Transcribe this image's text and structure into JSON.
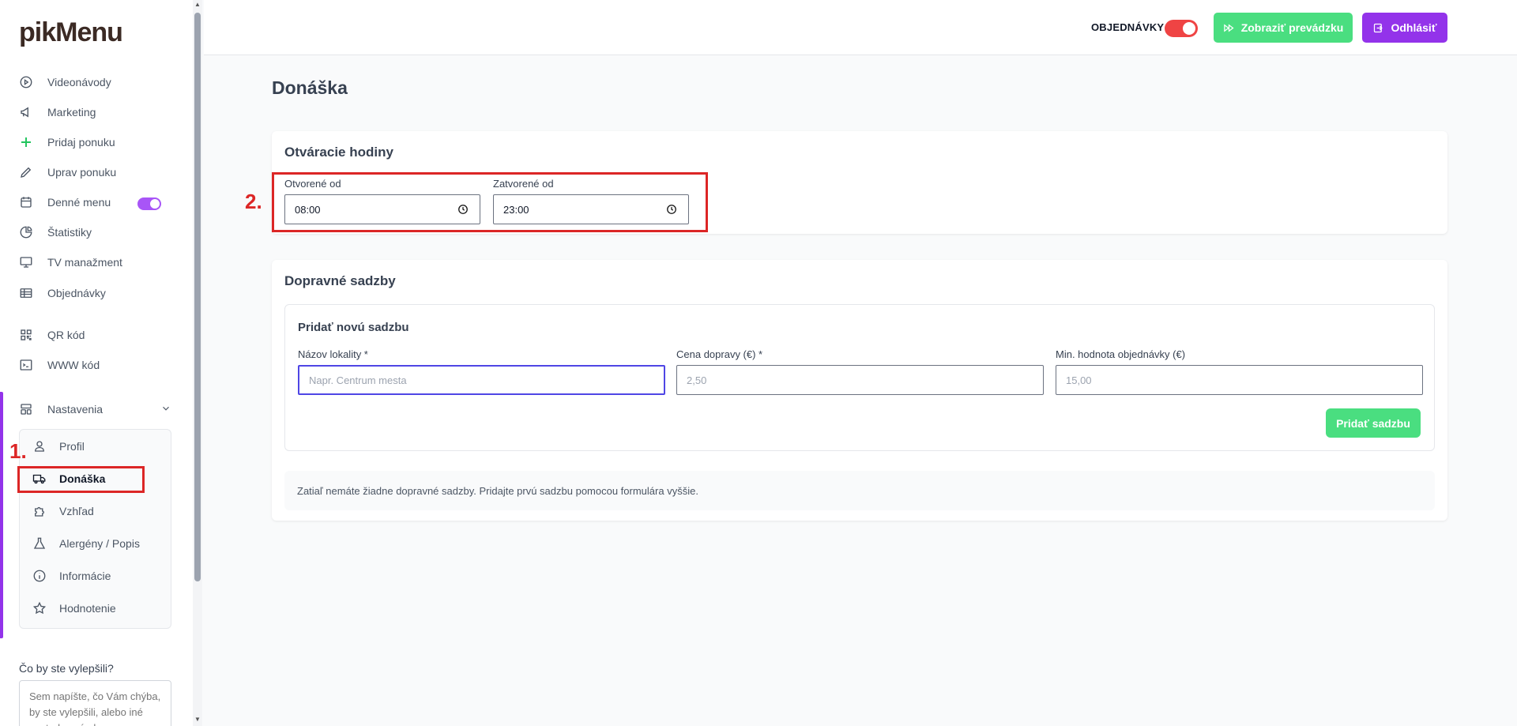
{
  "brand": {
    "logo": "pikMenu"
  },
  "sidebar": {
    "items": [
      {
        "label": "Videonávody",
        "icon": "play-circle-icon"
      },
      {
        "label": "Marketing",
        "icon": "megaphone-icon"
      },
      {
        "label": "Pridaj ponuku",
        "icon": "plus-icon"
      },
      {
        "label": "Uprav ponuku",
        "icon": "pencil-icon"
      },
      {
        "label": "Denné menu",
        "icon": "calendar-icon",
        "toggle": true
      },
      {
        "label": "Štatistiky",
        "icon": "pie-chart-icon"
      },
      {
        "label": "TV manažment",
        "icon": "monitor-icon"
      },
      {
        "label": "Objednávky",
        "icon": "table-icon"
      },
      {
        "label": "QR kód",
        "icon": "qr-code-icon"
      },
      {
        "label": "WWW kód",
        "icon": "code-icon"
      },
      {
        "label": "Nastavenia",
        "icon": "layout-icon"
      }
    ],
    "settings_submenu": [
      {
        "label": "Profil",
        "icon": "user-icon"
      },
      {
        "label": "Donáška",
        "icon": "truck-icon",
        "active": true
      },
      {
        "label": "Vzhľad",
        "icon": "puzzle-icon"
      },
      {
        "label": "Alergény / Popis",
        "icon": "flask-icon"
      },
      {
        "label": "Informácie",
        "icon": "info-icon"
      },
      {
        "label": "Hodnotenie",
        "icon": "star-icon"
      }
    ],
    "feedback": {
      "label": "Čo by ste vylepšili?",
      "placeholder": "Sem napíšte, čo Vám chýba, by ste vylepšili, alebo iné postrehy, návrhy"
    },
    "accent_color": "#9333ea"
  },
  "annotations": {
    "first": "1.",
    "second": "2."
  },
  "header": {
    "orders_label": "OBJEDNÁVKY",
    "orders_toggle_on": true,
    "show_shop_label": "Zobraziť prevádzku",
    "logout_label": "Odhlásiť",
    "green_color": "#4ade80",
    "purple_color": "#9333ea"
  },
  "main": {
    "title": "Donáška",
    "opening_hours": {
      "title": "Otváracie hodiny",
      "open_label": "Otvorené od",
      "open_value": "08:00",
      "close_label": "Zatvorené od",
      "close_value": "23:00"
    },
    "rates": {
      "title": "Dopravné sadzby",
      "form_title": "Pridať novú sadzbu",
      "locality_label": "Názov lokality *",
      "locality_placeholder": "Napr. Centrum mesta",
      "price_label": "Cena dopravy (€) *",
      "price_placeholder": "2,50",
      "min_label": "Min. hodnota objednávky (€)",
      "min_placeholder": "15,00",
      "add_button": "Pridať sadzbu",
      "empty_text": "Zatiaľ nemáte žiadne dopravné sadzby. Pridajte prvú sadzbu pomocou formulára vyššie."
    }
  }
}
